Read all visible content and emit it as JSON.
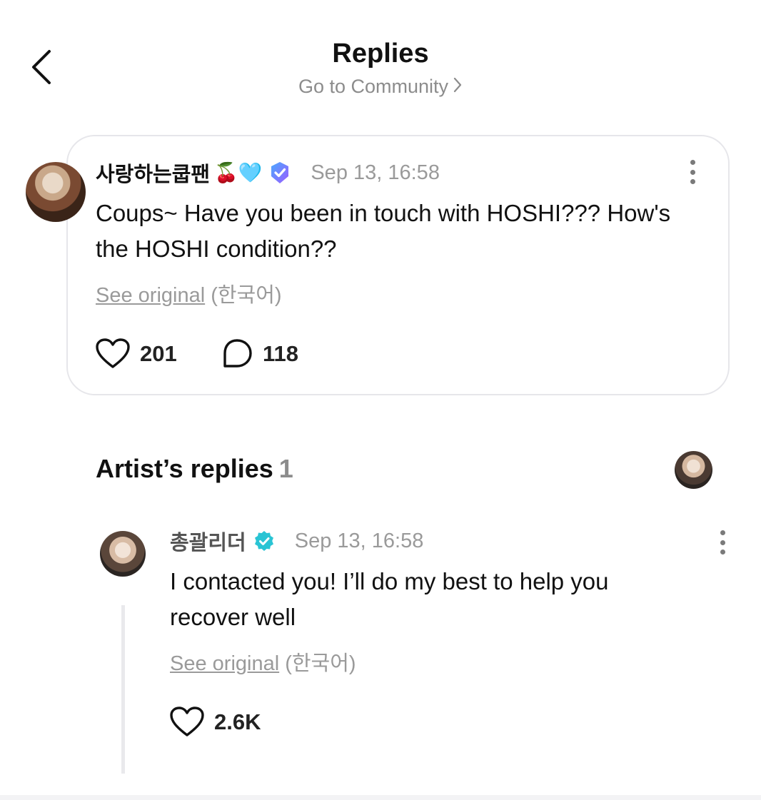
{
  "header": {
    "title": "Replies",
    "community_link": "Go to Community",
    "back_icon": "chevron-left-icon"
  },
  "post": {
    "author": "사랑하는쿱팬",
    "author_emojis": "🍒🩵",
    "badge_icon": "verified-membership-badge-icon",
    "timestamp": "Sep 13, 16:58",
    "body": "Coups~ Have you been in touch with HOSHI??? How's the HOSHI condition??",
    "see_original": "See original",
    "original_language": "(한국어)",
    "likes": "201",
    "comments": "118"
  },
  "artist_replies": {
    "title": "Artist’s replies",
    "count": "1",
    "replies": [
      {
        "author": "총괄리더",
        "badge_icon": "verified-artist-badge-icon",
        "timestamp": "Sep 13, 16:58",
        "body": "I contacted you! I’ll do my best to help you recover well",
        "see_original": "See original",
        "original_language": "(한국어)",
        "likes": "2.6K"
      }
    ]
  },
  "colors": {
    "accent_verified": "#29c4d4",
    "membership_badge": "#6a5cff",
    "muted_text": "#9a9a9a",
    "card_border": "#e6e6ea"
  }
}
